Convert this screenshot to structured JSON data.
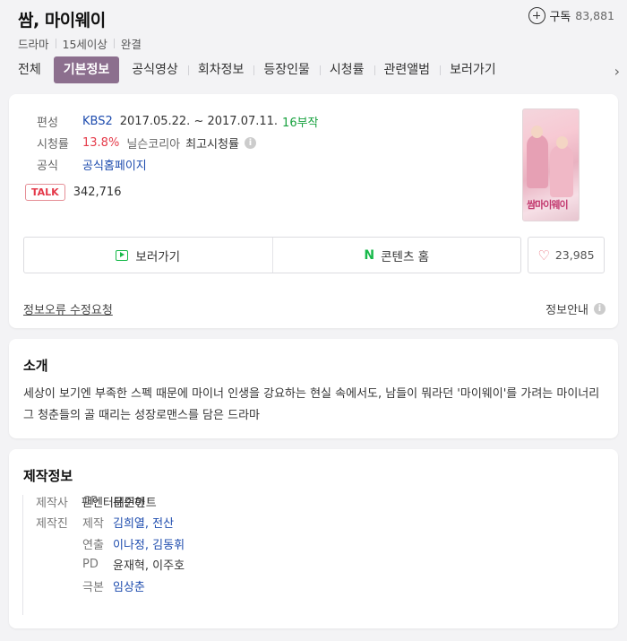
{
  "header": {
    "title": "쌈, 마이웨이",
    "meta": [
      "드라마",
      "15세이상",
      "완결"
    ],
    "subscribe_label": "구독",
    "subscribe_count": "83,881"
  },
  "tabs": [
    "전체",
    "기본정보",
    "공식영상",
    "회차정보",
    "등장인물",
    "시청률",
    "관련앨범",
    "보러가기"
  ],
  "active_tab": "기본정보",
  "info": {
    "broadcast_label": "편성",
    "channel": "KBS2",
    "period": "2017.05.22. ~ 2017.07.11.",
    "episodes": "16부작",
    "rating_label": "시청률",
    "rating_value": "13.8%",
    "rating_source": "닐슨코리아",
    "rating_type": "최고시청률",
    "official_label": "공식",
    "official_link": "공식홈페이지",
    "talk_badge": "TALK",
    "talk_count": "342,716",
    "poster_title": "쌈마이웨이"
  },
  "actions": {
    "watch_label": "보러가기",
    "content_home_label": "콘텐츠 홈",
    "content_home_icon": "N",
    "like_count": "23,985",
    "report_label": "정보오류 수정요청",
    "guide_label": "정보안내"
  },
  "intro": {
    "title": "소개",
    "text": "세상이 보기엔 부족한 스펙 때문에 마이너 인생을 강요하는 현실 속에서도, 남들이 뭐라던 '마이웨이'를 가려는 마이너리그 청춘들의 골 때리는 성장로맨스를 담은 드라마"
  },
  "production": {
    "title": "제작정보",
    "company_label": "제작사",
    "company": "팬엔터테인먼트",
    "staff_label": "제작진",
    "crew": [
      {
        "role": "CP",
        "names": "문준하"
      },
      {
        "role": "제작",
        "names": "김희열, 전산"
      },
      {
        "role": "연출",
        "names": "이나정, 김동휘"
      },
      {
        "role": "PD",
        "names": "윤재혁, 이주호"
      },
      {
        "role": "극본",
        "names": "임상춘"
      }
    ]
  },
  "colors": {
    "active_tab_bg": "#8c6f8e",
    "link_blue": "#1e4cae",
    "green": "#17a13e",
    "red": "#e53b4a"
  }
}
